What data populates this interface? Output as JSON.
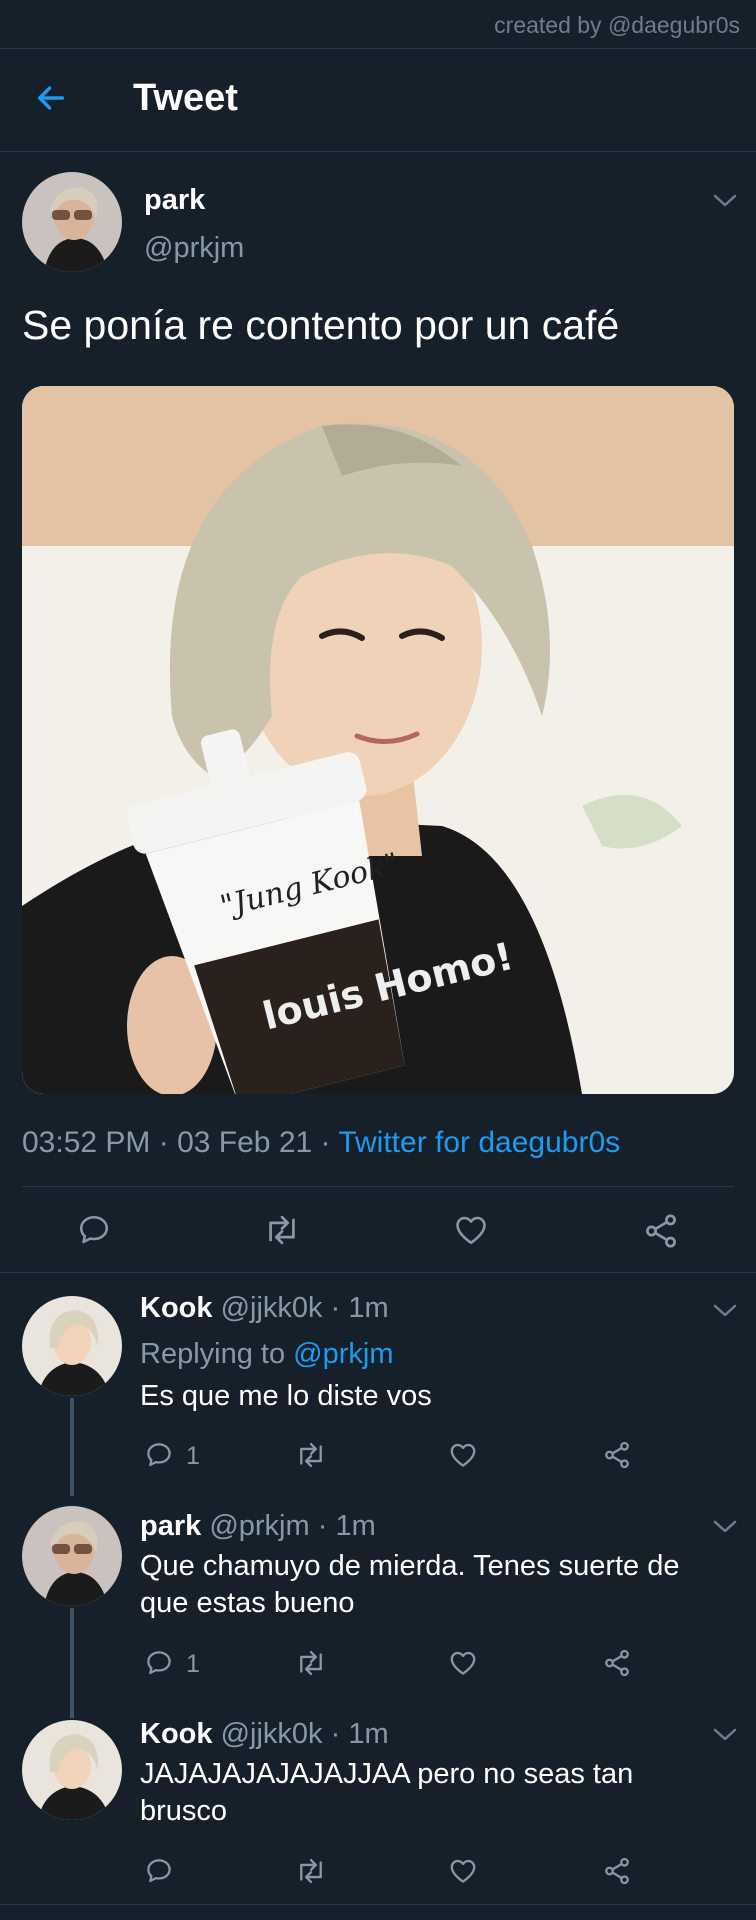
{
  "credit": "created by @daegubr0s",
  "header": {
    "title": "Tweet"
  },
  "tweet": {
    "name": "park",
    "handle": "@prkjm",
    "text": "Se ponía re contento por un café",
    "time": "03:52 PM",
    "date": "03 Feb 21",
    "source": "Twitter for daegubr0s",
    "media_text": {
      "cup_label": "\"Jung Kook\"",
      "sleeve_text": "louis Homo!"
    }
  },
  "replies": [
    {
      "name": "Kook",
      "handle": "@jjkk0k",
      "time": "1m",
      "replying_prefix": "Replying to",
      "replying_to": "@prkjm",
      "text": "Es que me lo diste vos",
      "reply_count": "1"
    },
    {
      "name": "park",
      "handle": "@prkjm",
      "time": "1m",
      "text": "Que chamuyo de mierda. Tenes suerte de que estas bueno",
      "reply_count": "1"
    },
    {
      "name": "Kook",
      "handle": "@jjkk0k",
      "time": "1m",
      "text": "JAJAJAJAJAJAJJAA pero no seas tan brusco"
    }
  ],
  "colors": {
    "background": "#15202b",
    "accent": "#1d9bf0",
    "muted": "#8899a6",
    "divider": "#2a3743"
  }
}
